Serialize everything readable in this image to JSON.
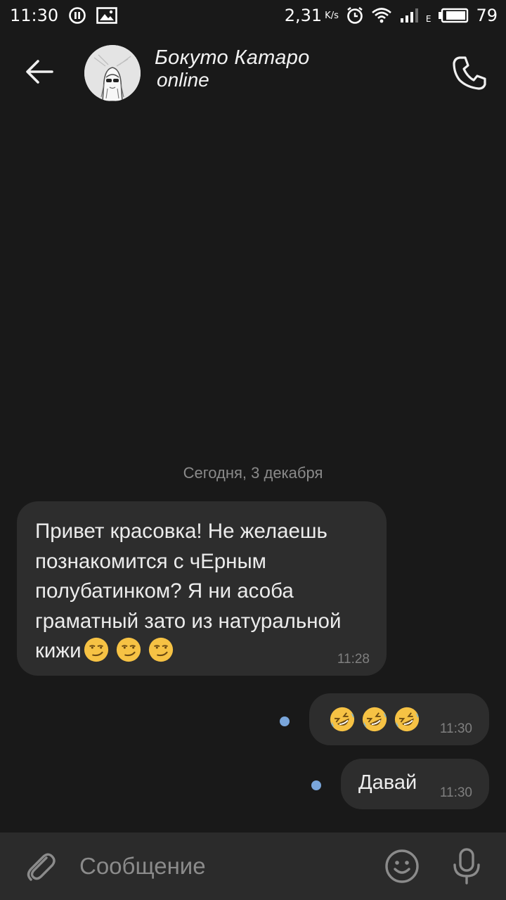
{
  "status_bar": {
    "time": "11:30",
    "speed": "2,31",
    "speed_unit": "K/s",
    "network_type": "E",
    "battery": "79",
    "icons": [
      "pause-circle-icon",
      "image-icon",
      "alarm-icon",
      "wifi-icon",
      "signal-icon",
      "battery-icon"
    ]
  },
  "header": {
    "contact_name": "Бокуто Катаро",
    "status": "online",
    "icons": [
      "back-arrow-icon",
      "avatar",
      "phone-icon"
    ]
  },
  "chat": {
    "date_separator": "Сегодня, 3 декабря",
    "messages": [
      {
        "direction": "incoming",
        "text": "Привет красовка! Не желаешь познакомится с чЕрным полубатинком? Я ни асоба граматный зато из натуральной кижи",
        "emoji": [
          "smirk",
          "smirk",
          "smirk"
        ],
        "time": "11:28"
      },
      {
        "direction": "outgoing",
        "text": "",
        "emoji": [
          "rofl",
          "rofl",
          "rofl"
        ],
        "time": "11:30",
        "unread": true
      },
      {
        "direction": "outgoing",
        "text": "Давай",
        "emoji": [],
        "time": "11:30",
        "unread": true
      }
    ]
  },
  "input_bar": {
    "placeholder": "Сообщение",
    "icons": [
      "paperclip-icon",
      "smiley-icon",
      "microphone-icon"
    ]
  },
  "colors": {
    "background": "#191919",
    "bubble": "#2d2d2d",
    "input_bar": "#2b2b2b",
    "unread_dot": "#7aa6db",
    "muted_text": "#8a8a8a"
  }
}
